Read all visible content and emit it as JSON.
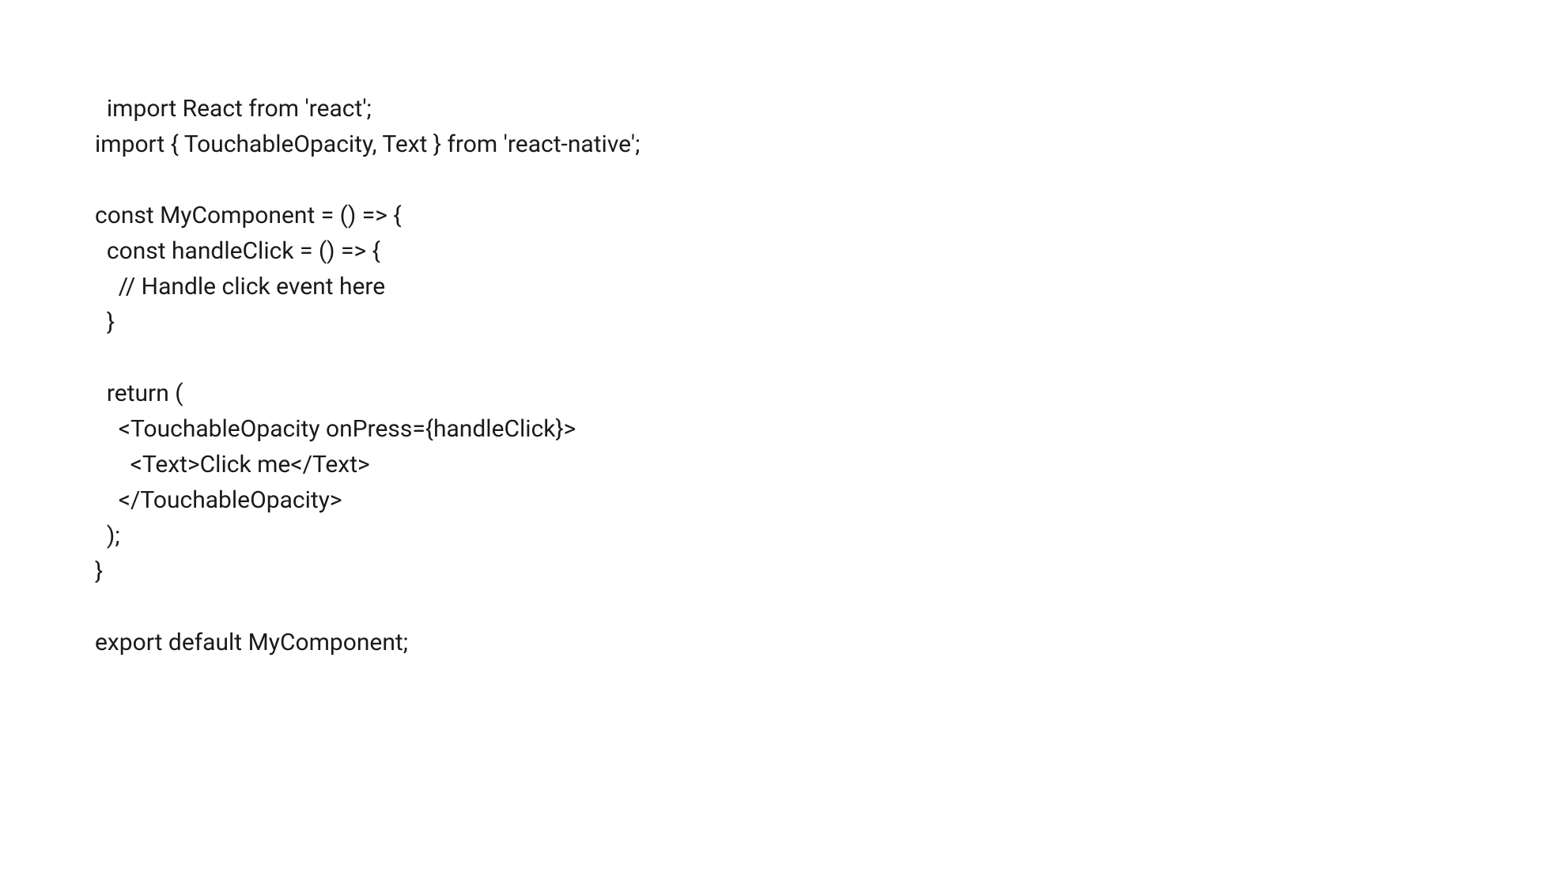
{
  "code": {
    "lines": [
      "import React from 'react';",
      "import { TouchableOpacity, Text } from 'react-native';",
      "",
      "const MyComponent = () => {",
      "  const handleClick = () => {",
      "    // Handle click event here",
      "  }",
      "",
      "  return (",
      "    <TouchableOpacity onPress={handleClick}>",
      "      <Text>Click me</Text>",
      "    </TouchableOpacity>",
      "  );",
      "}",
      "",
      "export default MyComponent;"
    ]
  }
}
